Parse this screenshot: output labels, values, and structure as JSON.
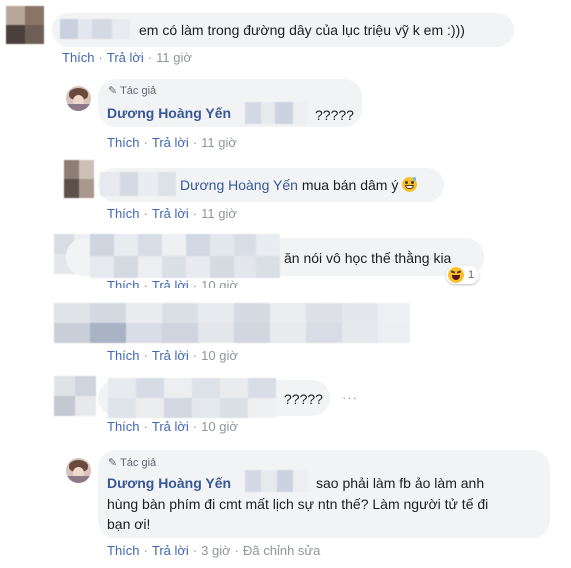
{
  "comments": [
    {
      "text": "em có làm trong đường dây của lục triệu vỹ k em :)))",
      "actions": {
        "like": "Thích",
        "reply": "Trả lời",
        "time": "11 giờ"
      }
    },
    {
      "author_tag": "Tác giả",
      "name": "Dương Hoàng Yến",
      "text": "?????",
      "actions": {
        "like": "Thích",
        "reply": "Trả lời",
        "time": "11 giờ"
      }
    },
    {
      "name": "Dương Hoàng Yến",
      "text": "mua bán dâm ý",
      "actions": {
        "like": "Thích",
        "reply": "Trả lời",
        "time": "11 giờ"
      }
    },
    {
      "text": "ăn nói vô học thế thằng kia",
      "reaction_count": "1",
      "actions": {
        "like": "Thích",
        "reply": "Trả lời",
        "time": "10 giờ"
      }
    },
    {
      "text": "",
      "actions": {
        "like": "Thích",
        "reply": "Trả lời",
        "time": "10 giờ"
      }
    },
    {
      "text": "?????",
      "more": "···",
      "actions": {
        "like": "Thích",
        "reply": "Trả lời",
        "time": "10 giờ"
      }
    },
    {
      "author_tag": "Tác giả",
      "name": "Dương Hoàng Yến",
      "text_line1": "sao phải làm fb ảo làm anh",
      "text_line2": "hùng bàn phím đi cmt mất lịch sự ntn thế? Làm người tử tế đi",
      "text_line3": "bạn ơi!",
      "actions": {
        "like": "Thích",
        "reply": "Trả lời",
        "time": "3 giờ",
        "edited": "Đã chỉnh sửa"
      }
    }
  ],
  "icons": {
    "pencil": "pencil-icon",
    "laugh": "laughing-emoji-icon",
    "grin": "grinning-sweat-emoji-icon"
  },
  "colors": {
    "link": "#4267b2",
    "name": "#385898",
    "bubble": "#f2f3f5",
    "muted": "#90949c"
  }
}
